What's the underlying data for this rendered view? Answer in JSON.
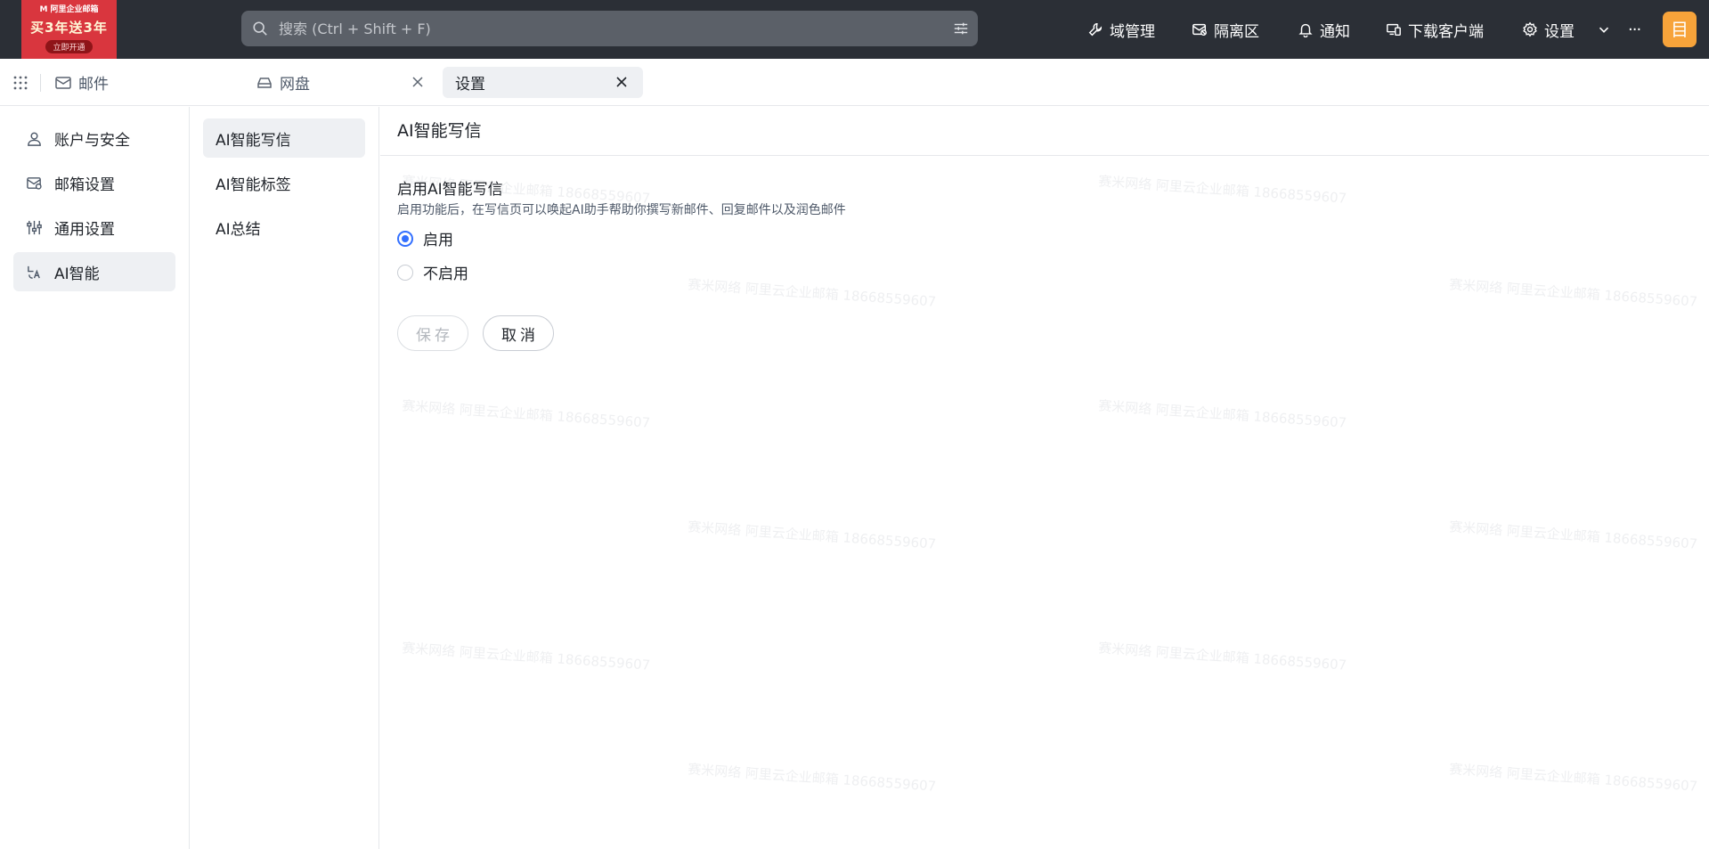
{
  "promo": {
    "brand": "M 阿里企业邮箱",
    "headline": "买3年送3年",
    "cta": "立即开通"
  },
  "search": {
    "placeholder": "搜索 (Ctrl + Shift + F)",
    "value": ""
  },
  "topnav": {
    "domain": "域管理",
    "quarantine": "隔离区",
    "notify": "通知",
    "download": "下载客户端",
    "settings": "设置",
    "more": "···",
    "avatar": "目"
  },
  "tabs": {
    "mail": "邮件",
    "disk": "网盘",
    "settings": "设置"
  },
  "sidebar": {
    "items": [
      "账户与安全",
      "邮箱设置",
      "通用设置",
      "AI智能"
    ]
  },
  "subnav": {
    "items": [
      "AI智能写信",
      "AI智能标签",
      "AI总结"
    ]
  },
  "main": {
    "title": "AI智能写信",
    "section_title": "启用AI智能写信",
    "section_desc": "启用功能后，在写信页可以唤起AI助手帮助你撰写新邮件、回复邮件以及润色邮件",
    "option_enable": "启用",
    "option_disable": "不启用",
    "save": "保存",
    "cancel": "取消"
  },
  "watermark": "赛米网络 阿里云企业邮箱 18668559607",
  "colors": {
    "topbar": "#2b2f36",
    "accent": "#3370ff",
    "promo": "#d9363e",
    "avatar": "#f7a33a"
  }
}
